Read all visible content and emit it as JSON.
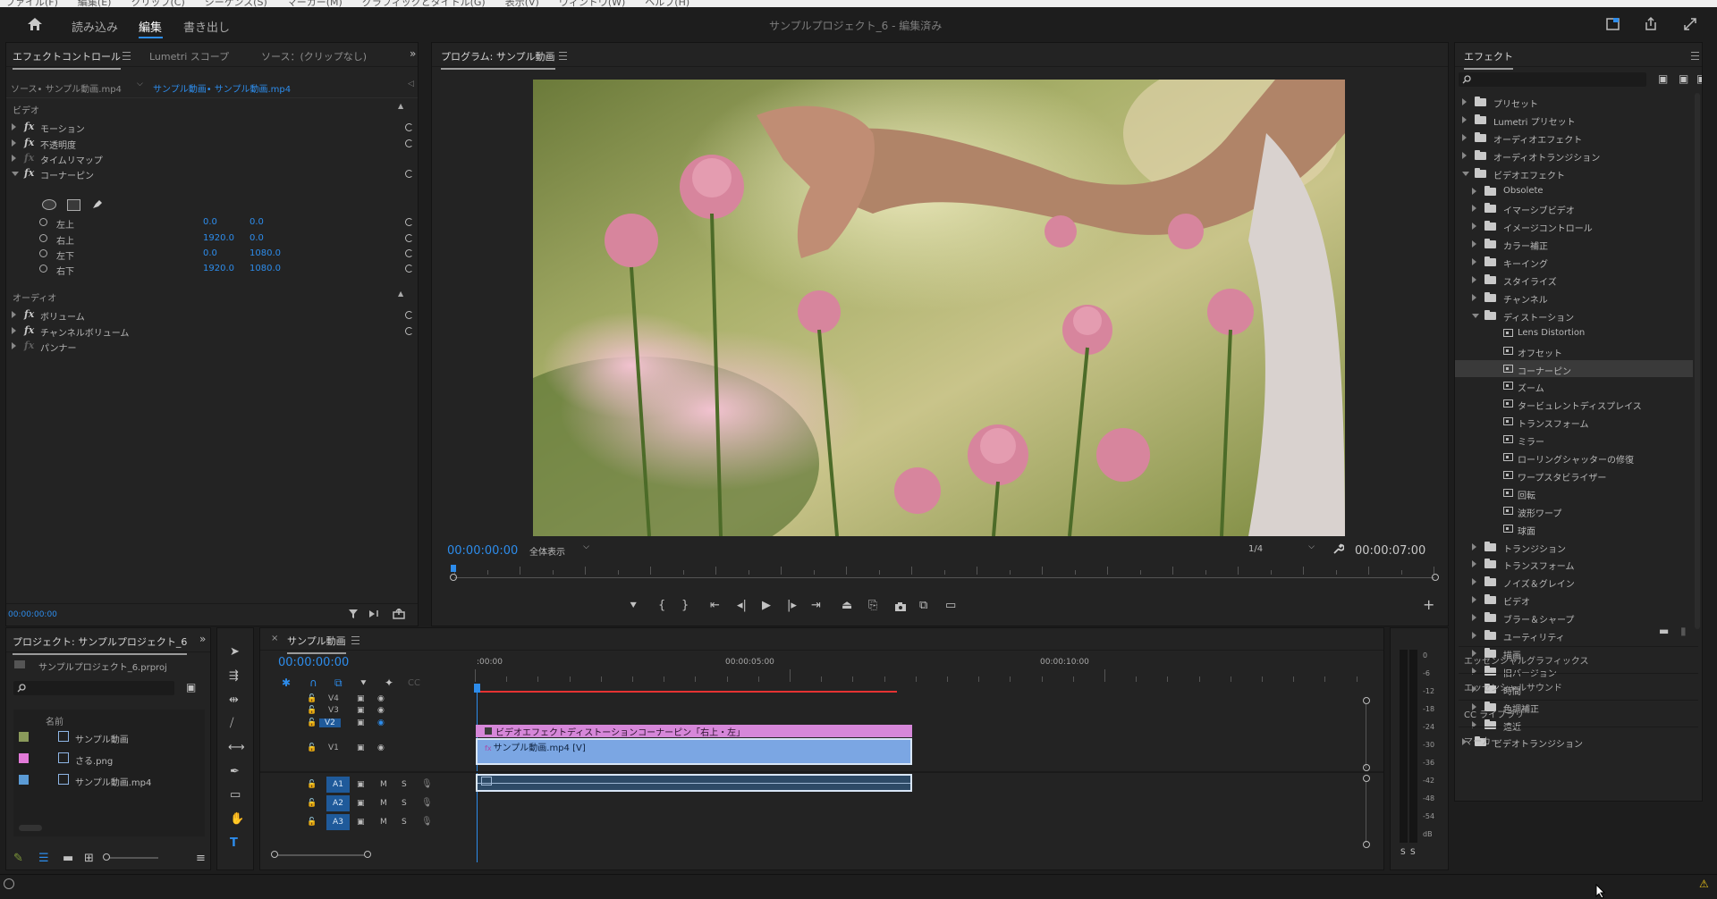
{
  "menubar": {
    "items": [
      "ファイル(F)",
      "編集(E)",
      "クリップ(C)",
      "シーケンス(S)",
      "マーカー(M)",
      "グラフィックとタイトル(G)",
      "表示(V)",
      "ウィンドウ(W)",
      "ヘルプ(H)"
    ]
  },
  "header": {
    "tabs": [
      "読み込み",
      "編集",
      "書き出し"
    ],
    "title": "サンプルプロジェクト_6 - 編集済み"
  },
  "effect_controls": {
    "tabs": [
      "エフェクトコントロール",
      "Lumetri スコープ",
      "ソース：(クリップなし)"
    ],
    "source_label": "ソース• サンプル動画.mp4",
    "clip_label": "サンプル動画• サンプル動画.mp4",
    "video_section": "ビデオ",
    "video_effects": [
      "モーション",
      "不透明度",
      "タイムリマップ",
      "コーナーピン"
    ],
    "corner_params": [
      {
        "label": "左上",
        "x": "0.0",
        "y": "0.0"
      },
      {
        "label": "右上",
        "x": "1920.0",
        "y": "0.0"
      },
      {
        "label": "左下",
        "x": "0.0",
        "y": "1080.0"
      },
      {
        "label": "右下",
        "x": "1920.0",
        "y": "1080.0"
      }
    ],
    "audio_section": "オーディオ",
    "audio_effects": [
      "ボリューム",
      "チャンネルボリューム",
      "パンナー"
    ],
    "timecode": "00:00:00:00"
  },
  "program": {
    "title": "プログラム: サンプル動画",
    "timecode": "00:00:00:00",
    "zoom": "全体表示",
    "resolution": "1/4",
    "duration": "00:00:07:00"
  },
  "effects_panel": {
    "title": "エフェクト",
    "tree": [
      {
        "label": "プリセット",
        "level": 0,
        "kind": "folder",
        "open": false
      },
      {
        "label": "Lumetri プリセット",
        "level": 0,
        "kind": "folder",
        "open": false
      },
      {
        "label": "オーディオエフェクト",
        "level": 0,
        "kind": "folder",
        "open": false
      },
      {
        "label": "オーディオトランジション",
        "level": 0,
        "kind": "folder",
        "open": false
      },
      {
        "label": "ビデオエフェクト",
        "level": 0,
        "kind": "folder",
        "open": true
      },
      {
        "label": "Obsolete",
        "level": 1,
        "kind": "folder",
        "open": false
      },
      {
        "label": "イマーシブビデオ",
        "level": 1,
        "kind": "folder",
        "open": false
      },
      {
        "label": "イメージコントロール",
        "level": 1,
        "kind": "folder",
        "open": false
      },
      {
        "label": "カラー補正",
        "level": 1,
        "kind": "folder",
        "open": false
      },
      {
        "label": "キーイング",
        "level": 1,
        "kind": "folder",
        "open": false
      },
      {
        "label": "スタイライズ",
        "level": 1,
        "kind": "folder",
        "open": false
      },
      {
        "label": "チャンネル",
        "level": 1,
        "kind": "folder",
        "open": false
      },
      {
        "label": "ディストーション",
        "level": 1,
        "kind": "folder",
        "open": true
      },
      {
        "label": "Lens Distortion",
        "level": 2,
        "kind": "effect"
      },
      {
        "label": "オフセット",
        "level": 2,
        "kind": "effect"
      },
      {
        "label": "コーナーピン",
        "level": 2,
        "kind": "effect",
        "selected": true
      },
      {
        "label": "ズーム",
        "level": 2,
        "kind": "effect"
      },
      {
        "label": "タービュレントディスプレイス",
        "level": 2,
        "kind": "effect"
      },
      {
        "label": "トランスフォーム",
        "level": 2,
        "kind": "effect"
      },
      {
        "label": "ミラー",
        "level": 2,
        "kind": "effect"
      },
      {
        "label": "ローリングシャッターの修復",
        "level": 2,
        "kind": "effect"
      },
      {
        "label": "ワープスタビライザー",
        "level": 2,
        "kind": "effect"
      },
      {
        "label": "回転",
        "level": 2,
        "kind": "effect"
      },
      {
        "label": "波形ワープ",
        "level": 2,
        "kind": "effect"
      },
      {
        "label": "球面",
        "level": 2,
        "kind": "effect"
      },
      {
        "label": "トランジション",
        "level": 1,
        "kind": "folder",
        "open": false
      },
      {
        "label": "トランスフォーム",
        "level": 1,
        "kind": "folder",
        "open": false
      },
      {
        "label": "ノイズ＆グレイン",
        "level": 1,
        "kind": "folder",
        "open": false
      },
      {
        "label": "ビデオ",
        "level": 1,
        "kind": "folder",
        "open": false
      },
      {
        "label": "ブラー＆シャープ",
        "level": 1,
        "kind": "folder",
        "open": false
      },
      {
        "label": "ユーティリティ",
        "level": 1,
        "kind": "folder",
        "open": false
      },
      {
        "label": "描画",
        "level": 1,
        "kind": "folder",
        "open": false
      },
      {
        "label": "旧バージョン",
        "level": 1,
        "kind": "folder",
        "open": false
      },
      {
        "label": "時間",
        "level": 1,
        "kind": "folder",
        "open": false
      },
      {
        "label": "色調補正",
        "level": 1,
        "kind": "folder",
        "open": false
      },
      {
        "label": "遠近",
        "level": 1,
        "kind": "folder",
        "open": false
      },
      {
        "label": "ビデオトランジション",
        "level": 0,
        "kind": "folder",
        "open": false
      }
    ],
    "bottom_sections": [
      "エッセンシャルグラフィックス",
      "エッセンシャルサウンド",
      "CC ライブラリ",
      "マーカー"
    ]
  },
  "project": {
    "title": "プロジェクト: サンプルプロジェクト_6",
    "file": "サンプルプロジェクト_6.prproj",
    "column_name": "名前",
    "items": [
      {
        "name": "サンプル動画",
        "color": "#8a9a5b",
        "icon": "sequence-icon"
      },
      {
        "name": "さる.png",
        "color": "#e27ad8",
        "icon": "image-icon"
      },
      {
        "name": "サンプル動画.mp4",
        "color": "#5b9bd5",
        "icon": "video-icon"
      }
    ]
  },
  "timeline": {
    "tab": "サンプル動画",
    "timecode": "00:00:00:00",
    "ruler": [
      ":00:00",
      "00:00:05:00",
      "00:00:10:00"
    ],
    "video_tracks": [
      "V4",
      "V3",
      "V2",
      "V1"
    ],
    "audio_tracks": [
      "A1",
      "A2",
      "A3"
    ],
    "clip_v2": "ビデオエフェクトディストーションコーナーピン「右上・左」",
    "clip_v1": "サンプル動画.mp4 [V]",
    "track_buttons": {
      "mute": "M",
      "solo": "S"
    }
  },
  "audio_meter": {
    "scale": [
      "0",
      "-6",
      "-12",
      "-18",
      "-24",
      "-30",
      "-36",
      "-42",
      "-48",
      "-54",
      "dB"
    ],
    "solo_labels": [
      "S",
      "S"
    ]
  },
  "colors": {
    "accent": "#2d8ceb",
    "clip_v2": "#d687d9",
    "clip_v1": "#7ba6e3",
    "playhead": "#e63232"
  }
}
